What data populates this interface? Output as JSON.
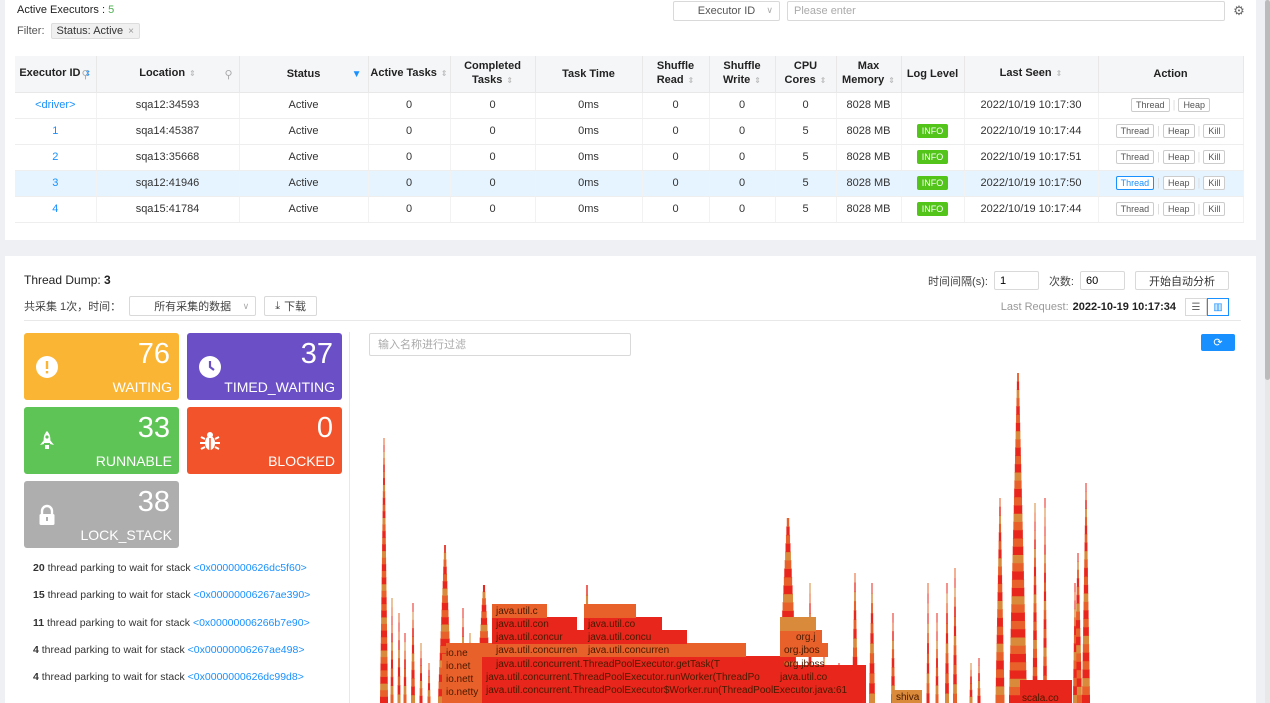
{
  "header": {
    "active_label": "Active Executors : ",
    "active_count": "5",
    "filter_label": "Filter:",
    "filter_tag": "Status: Active",
    "filter_close": "×",
    "executor_select": "Executor ID",
    "search_placeholder": "Please enter"
  },
  "table": {
    "headers": [
      "Executor ID",
      "Location",
      "Status",
      "Active Tasks",
      "Completed Tasks",
      "Task Time",
      "Shuffle Read",
      "Shuffle Write",
      "CPU Cores",
      "Max Memory",
      "Log Level",
      "Last Seen",
      "Action"
    ],
    "rows": [
      {
        "id": "<driver>",
        "location": "sqa12:34593",
        "status": "Active",
        "active_tasks": "0",
        "completed": "0",
        "task_time": "0ms",
        "shuffle_read": "0",
        "shuffle_write": "0",
        "cores": "0",
        "memory": "8028 MB",
        "log_level": "",
        "last_seen": "2022/10/19 10:17:30",
        "actions": [
          "Thread",
          "Heap"
        ]
      },
      {
        "id": "1",
        "location": "sqa14:45387",
        "status": "Active",
        "active_tasks": "0",
        "completed": "0",
        "task_time": "0ms",
        "shuffle_read": "0",
        "shuffle_write": "0",
        "cores": "5",
        "memory": "8028 MB",
        "log_level": "INFO",
        "last_seen": "2022/10/19 10:17:44",
        "actions": [
          "Thread",
          "Heap",
          "Kill"
        ]
      },
      {
        "id": "2",
        "location": "sqa13:35668",
        "status": "Active",
        "active_tasks": "0",
        "completed": "0",
        "task_time": "0ms",
        "shuffle_read": "0",
        "shuffle_write": "0",
        "cores": "5",
        "memory": "8028 MB",
        "log_level": "INFO",
        "last_seen": "2022/10/19 10:17:51",
        "actions": [
          "Thread",
          "Heap",
          "Kill"
        ]
      },
      {
        "id": "3",
        "location": "sqa12:41946",
        "status": "Active",
        "active_tasks": "0",
        "completed": "0",
        "task_time": "0ms",
        "shuffle_read": "0",
        "shuffle_write": "0",
        "cores": "5",
        "memory": "8028 MB",
        "log_level": "INFO",
        "last_seen": "2022/10/19 10:17:50",
        "actions": [
          "Thread",
          "Heap",
          "Kill"
        ],
        "selected": true
      },
      {
        "id": "4",
        "location": "sqa15:41784",
        "status": "Active",
        "active_tasks": "0",
        "completed": "0",
        "task_time": "0ms",
        "shuffle_read": "0",
        "shuffle_write": "0",
        "cores": "5",
        "memory": "8028 MB",
        "log_level": "INFO",
        "last_seen": "2022/10/19 10:17:44",
        "actions": [
          "Thread",
          "Heap",
          "Kill"
        ]
      }
    ]
  },
  "thread_dump": {
    "title": "Thread Dump: ",
    "title_count": "3",
    "collect_label": "共采集 1次，时间：",
    "collect_select": "所有采集的数据",
    "download_label": "下载",
    "interval_label": "时间间隔(s):",
    "interval_value": "1",
    "count_label": "次数:",
    "count_value": "60",
    "auto_btn": "开始自动分析",
    "last_request_label": "Last Request:",
    "last_request_value": "2022-10-19 10:17:34",
    "name_filter_placeholder": "输入名称进行过滤"
  },
  "cards": {
    "waiting": {
      "num": "76",
      "label": "WAITING",
      "icon": "exclamation-icon"
    },
    "timed": {
      "num": "37",
      "label": "TIMED_WAITING",
      "icon": "clock-icon"
    },
    "runnable": {
      "num": "33",
      "label": "RUNNABLE",
      "icon": "rocket-icon"
    },
    "blocked": {
      "num": "0",
      "label": "BLOCKED",
      "icon": "bug-icon"
    },
    "lock": {
      "num": "38",
      "label": "LOCK_STACK",
      "icon": "lock-icon"
    }
  },
  "stacks": [
    {
      "count": "20",
      "text": " thread parking to wait for stack ",
      "addr": "<0x0000000626dc5f60>"
    },
    {
      "count": "15",
      "text": " thread parking to wait for stack ",
      "addr": "<0x00000006267ae390>"
    },
    {
      "count": "11",
      "text": " thread parking to wait for stack ",
      "addr": "<0x00000006266b7e90>"
    },
    {
      "count": "4",
      "text": " thread parking to wait for stack ",
      "addr": "<0x00000006267ae498>"
    },
    {
      "count": "4",
      "text": " thread parking to wait for stack ",
      "addr": "<0x0000000626dc99d8>"
    }
  ],
  "flame": {
    "labels": [
      "java.util.c",
      "java.util.con",
      "java.util.concur",
      "java.util.concurren",
      "java.util.concurrent.ThreadPoolExecutor.getTask(T",
      "java.util.concurrent.ThreadPoolExecutor.runWorker(ThreadPo",
      "java.util.concurrent.ThreadPoolExecutor$Worker.run(ThreadPoolExecutor.java:61",
      "java.util.co",
      "java.util.concu",
      "io.ne",
      "io.net",
      "io.nett",
      "io.netty",
      "org.j",
      "org.jbos",
      "org.jboss",
      "java.util.co",
      "shiva",
      "scala.co"
    ],
    "colors": {
      "red": "#e8261c",
      "orange": "#e8602a",
      "tan": "#d98a3a"
    }
  }
}
